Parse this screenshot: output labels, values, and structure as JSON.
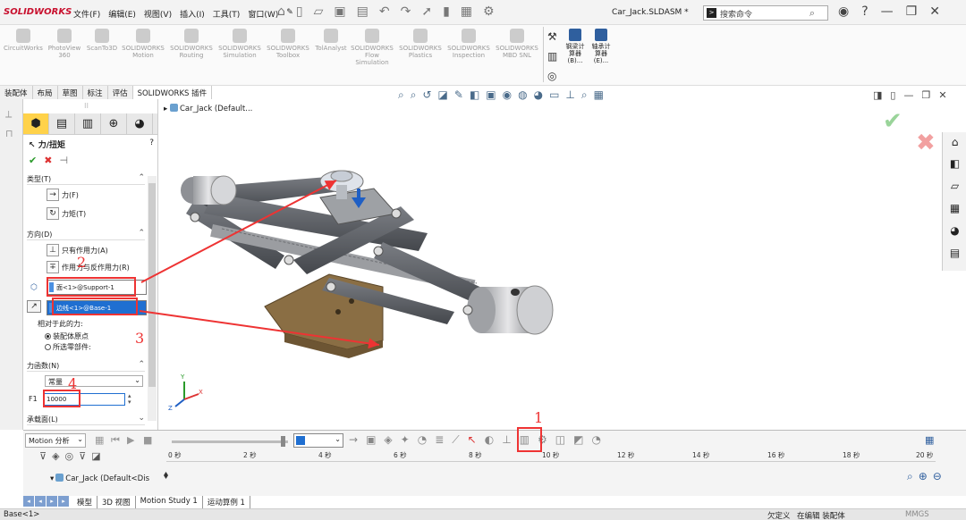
{
  "app": {
    "logo": "SOLIDWORKS",
    "menu": [
      "文件(F)",
      "编辑(E)",
      "视图(V)",
      "插入(I)",
      "工具(T)",
      "窗口(W)"
    ],
    "document_title": "Car_Jack.SLDASM *",
    "search_placeholder": "搜索命令"
  },
  "ribbon": {
    "addins": [
      {
        "label": "CircuitWorks"
      },
      {
        "label": "PhotoView 360"
      },
      {
        "label": "ScanTo3D"
      },
      {
        "label": "SOLIDWORKS Motion"
      },
      {
        "label": "SOLIDWORKS Routing"
      },
      {
        "label": "SOLIDWORKS Simulation"
      },
      {
        "label": "SOLIDWORKS Toolbox"
      },
      {
        "label": "TolAnalyst"
      },
      {
        "label": "SOLIDWORKS Flow Simulation"
      },
      {
        "label": "SOLIDWORKS Plastics"
      },
      {
        "label": "SOLIDWORKS Inspection"
      },
      {
        "label": "SOLIDWORKS MBD SNL"
      }
    ],
    "tools": [
      {
        "label": "钢梁计算器 (B)..."
      },
      {
        "label": "轴承计算器 (E)..."
      }
    ]
  },
  "command_tabs": [
    "装配体",
    "布局",
    "草图",
    "标注",
    "评估",
    "SOLIDWORKS 插件"
  ],
  "property_manager": {
    "title": "力/扭矩",
    "help": "?",
    "type_section": "类型(T)",
    "type_options": [
      "力(F)",
      "力矩(T)"
    ],
    "direction_section": "方向(D)",
    "direction_options": [
      "只有作用力(A)",
      "作用力与反作用力(R)"
    ],
    "selection_face": "面<1>@Support-1",
    "selection_edge": "边线<1>@Base-1",
    "relative_label": "相对于此的力:",
    "relative_options": [
      "装配体原点",
      "所选零部件:"
    ],
    "relative_selected": 0,
    "function_section": "力函数(N)",
    "function_value": "常量",
    "f1_label": "F1",
    "f1_value": "10000",
    "load_face_section": "承载面(L)"
  },
  "viewport": {
    "tree_root": "Car_Jack  (Default...",
    "triad_axes": [
      "X",
      "Y",
      "Z"
    ]
  },
  "motion": {
    "study_type": "Motion 分析",
    "timeline_labels": [
      "0 秒",
      "2 秒",
      "4 秒",
      "6 秒",
      "8 秒",
      "10 秒",
      "12 秒",
      "14 秒",
      "16 秒",
      "18 秒",
      "20 秒"
    ],
    "tree_row": "Car_Jack  (Default<Dis"
  },
  "bottom_tabs": [
    "模型",
    "3D 视图",
    "Motion Study 1",
    "运动算例 1"
  ],
  "bottom_tab_active": 3,
  "status": {
    "left": "Base<1>",
    "state": "欠定义",
    "editing": "在编辑 装配体",
    "units": "MMGS"
  },
  "annotations": [
    "1",
    "2",
    "3",
    "4"
  ],
  "colors": {
    "accent_blue": "#1f6fd1",
    "annotation_red": "#e33333",
    "model_gray": "#5a5d63",
    "base_brown": "#8a6e44"
  }
}
